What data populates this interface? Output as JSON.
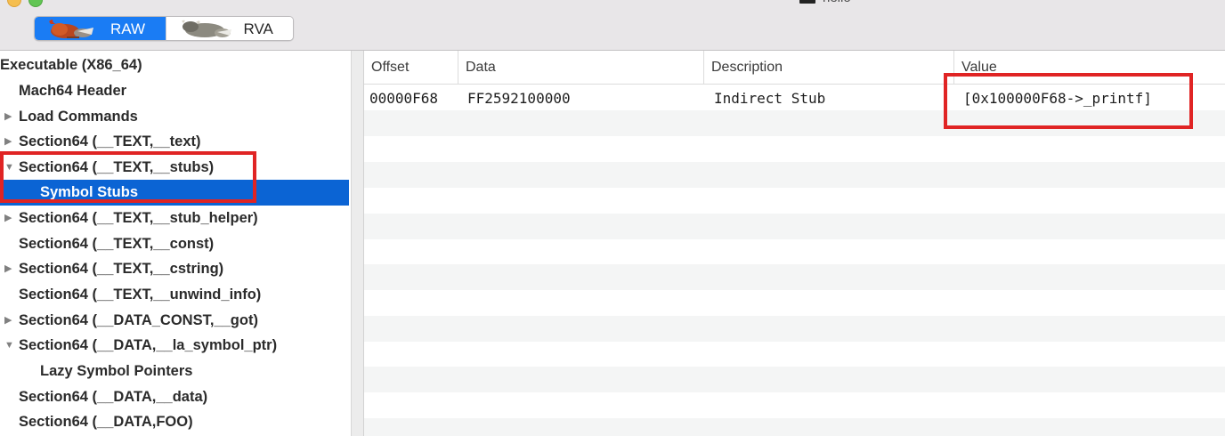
{
  "window": {
    "title": "hello"
  },
  "toolbar": {
    "raw_label": "RAW",
    "rva_label": "RVA",
    "selected": "RAW"
  },
  "sidebar": {
    "items": [
      {
        "label": "Executable  (X86_64)",
        "disclosure": "none",
        "indent": 0
      },
      {
        "label": "Mach64 Header",
        "disclosure": "none",
        "indent": 1
      },
      {
        "label": "Load Commands",
        "disclosure": "collapsed",
        "indent": 1
      },
      {
        "label": "Section64 (__TEXT,__text)",
        "disclosure": "collapsed",
        "indent": 1
      },
      {
        "label": "Section64 (__TEXT,__stubs)",
        "disclosure": "expanded",
        "indent": 1
      },
      {
        "label": "Symbol Stubs",
        "disclosure": "none",
        "indent": 2,
        "selected": true
      },
      {
        "label": "Section64 (__TEXT,__stub_helper)",
        "disclosure": "collapsed",
        "indent": 1
      },
      {
        "label": "Section64 (__TEXT,__const)",
        "disclosure": "none",
        "indent": 1
      },
      {
        "label": "Section64 (__TEXT,__cstring)",
        "disclosure": "collapsed",
        "indent": 1
      },
      {
        "label": "Section64 (__TEXT,__unwind_info)",
        "disclosure": "none",
        "indent": 1
      },
      {
        "label": "Section64 (__DATA_CONST,__got)",
        "disclosure": "collapsed",
        "indent": 1
      },
      {
        "label": "Section64 (__DATA,__la_symbol_ptr)",
        "disclosure": "expanded",
        "indent": 1
      },
      {
        "label": "Lazy Symbol Pointers",
        "disclosure": "none",
        "indent": 2
      },
      {
        "label": "Section64 (__DATA,__data)",
        "disclosure": "none",
        "indent": 1
      },
      {
        "label": "Section64 (__DATA,FOO)",
        "disclosure": "none",
        "indent": 1
      }
    ]
  },
  "table": {
    "columns": [
      "Offset",
      "Data",
      "Description",
      "Value"
    ],
    "rows": [
      {
        "offset": "00000F68",
        "data": "FF2592100000",
        "description": "Indirect Stub",
        "value": "[0x100000F68->_printf]"
      }
    ]
  },
  "colors": {
    "selection": "#0b64d4",
    "segment_selected": "#1a7cf4",
    "annotation": "#e02424",
    "stripe": "#f4f5f5"
  },
  "icons": {
    "raw_image": "rooster-image",
    "rva_image": "bull-image",
    "collapsed": "disclosure-triangle-right-icon",
    "expanded": "disclosure-triangle-down-icon"
  }
}
